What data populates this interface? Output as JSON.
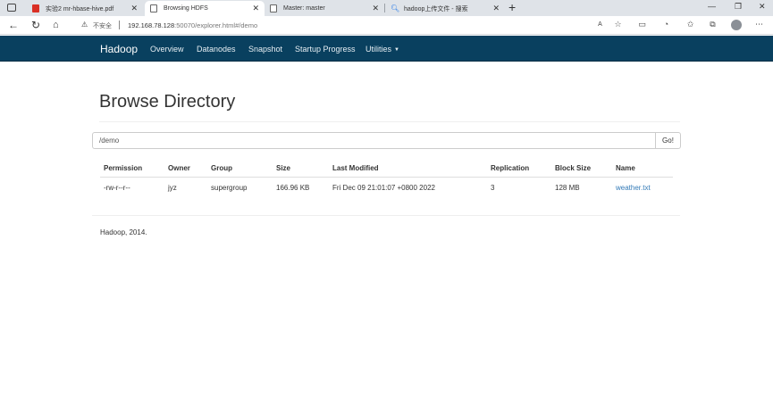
{
  "browser": {
    "tabs": [
      {
        "title": "实验2 mr-hbase-hive.pdf",
        "icon": "pdf-icon"
      },
      {
        "title": "Browsing HDFS",
        "icon": "page-icon"
      },
      {
        "title": "Master: master",
        "icon": "page-icon"
      },
      {
        "title": "hadoop上传文件 - 搜索",
        "icon": "search-icon"
      }
    ],
    "insecure_label": "不安全",
    "url_host": "192.168.78.128",
    "url_rest": ":50070/explorer.html#/demo"
  },
  "navbar": {
    "brand": "Hadoop",
    "links": [
      "Overview",
      "Datanodes",
      "Snapshot",
      "Startup Progress",
      "Utilities"
    ]
  },
  "page": {
    "title": "Browse Directory",
    "directory_value": "/demo",
    "go_label": "Go!"
  },
  "table": {
    "headers": [
      "Permission",
      "Owner",
      "Group",
      "Size",
      "Last Modified",
      "Replication",
      "Block Size",
      "Name"
    ],
    "rows": [
      [
        "-rw-r--r--",
        "jyz",
        "supergroup",
        "166.96 KB",
        "Fri Dec 09 21:01:07 +0800 2022",
        "3",
        "128 MB",
        "weather.txt"
      ]
    ]
  },
  "footer": "Hadoop, 2014.",
  "colors": {
    "navbar_bg": "#09405f",
    "link": "#337ab7"
  }
}
